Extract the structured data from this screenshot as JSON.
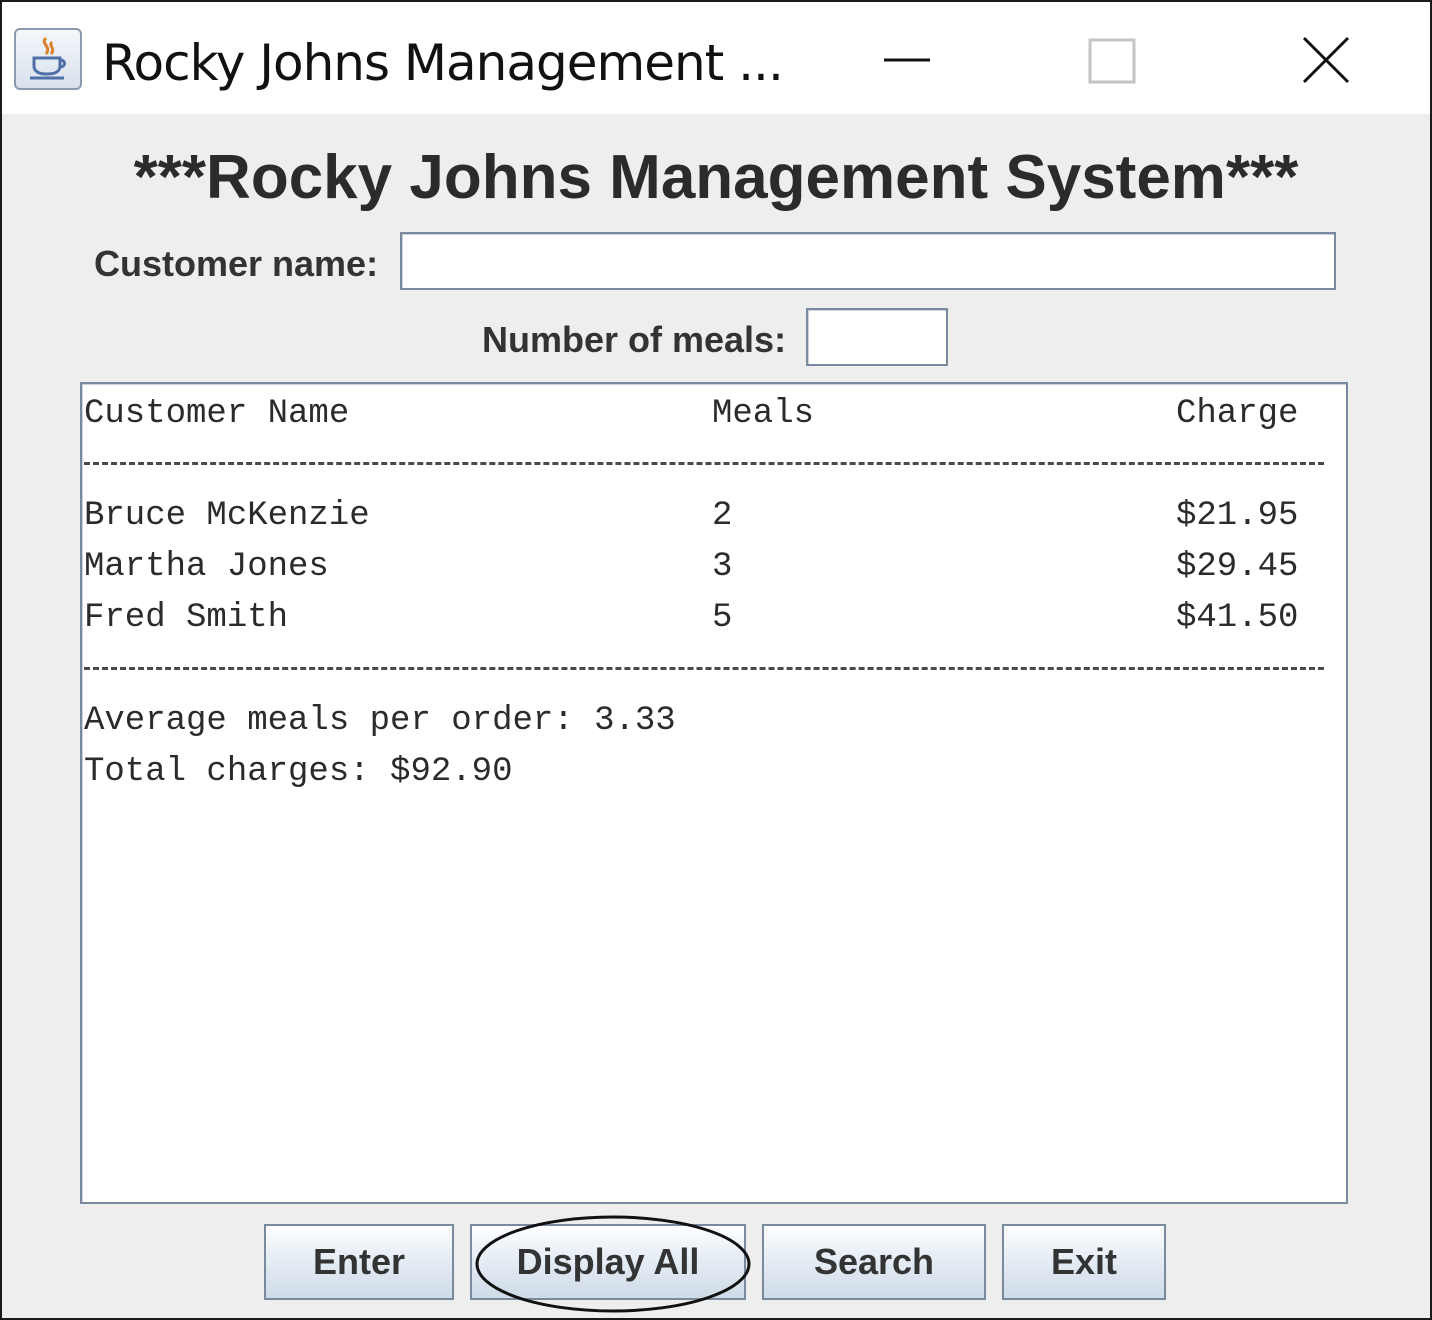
{
  "window": {
    "title": "Rocky Johns Management ...",
    "icon": "java-icon",
    "controls": [
      "minimize-icon",
      "maximize-icon",
      "close-icon"
    ]
  },
  "heading": "***Rocky Johns Management System***",
  "form": {
    "customer_name_label": "Customer name:",
    "customer_name_value": "",
    "meals_label": "Number of meals:",
    "meals_value": ""
  },
  "output": {
    "headers": {
      "name": "Customer Name",
      "meals": "Meals",
      "charge": "Charge"
    },
    "rows": [
      {
        "name": "Bruce McKenzie",
        "meals": "2",
        "charge": "$21.95"
      },
      {
        "name": "Martha Jones",
        "meals": "3",
        "charge": "$29.45"
      },
      {
        "name": "Fred Smith",
        "meals": "5",
        "charge": "$41.50"
      }
    ],
    "average_line": "Average meals per order: 3.33",
    "total_line": "Total charges: $92.90"
  },
  "buttons": {
    "enter": "Enter",
    "display_all": "Display All",
    "search": "Search",
    "exit": "Exit"
  },
  "colors": {
    "panel_bg": "#eeeeee",
    "text": "#333333",
    "button_border": "#7a8a9e"
  }
}
